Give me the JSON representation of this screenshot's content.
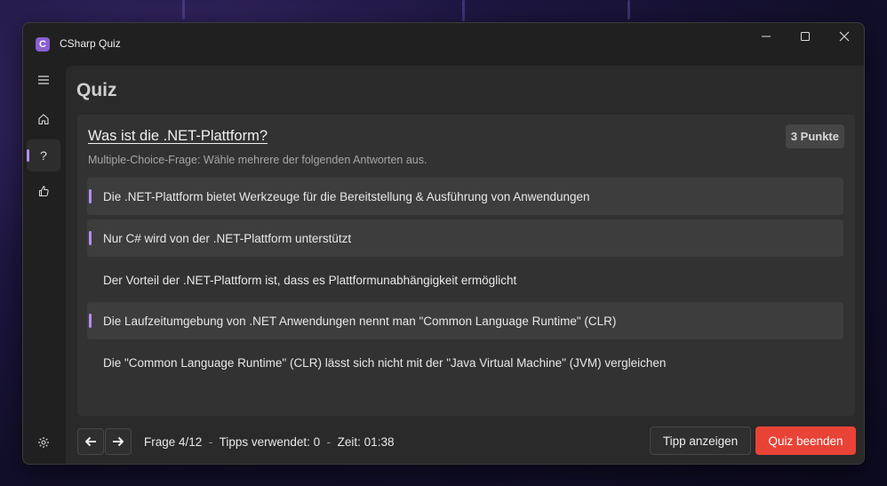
{
  "window": {
    "app_title": "CSharp Quiz",
    "app_logo_glyph": "C",
    "icons": [
      "minimize-icon",
      "maximize-icon",
      "close-icon"
    ]
  },
  "sidebar": {
    "items": [
      {
        "name": "menu",
        "icon": "hamburger-icon",
        "glyph": "≡"
      },
      {
        "name": "home",
        "icon": "home-icon"
      },
      {
        "name": "quiz",
        "icon": "question-icon",
        "glyph": "?",
        "active": true
      },
      {
        "name": "like",
        "icon": "thumbs-up-icon"
      },
      {
        "name": "settings",
        "icon": "gear-icon"
      }
    ]
  },
  "page": {
    "title": "Quiz"
  },
  "question": {
    "text": "Was ist die .NET-Plattform?",
    "points": "3 Punkte",
    "instruction": "Multiple-Choice-Frage: Wähle mehrere der folgenden Antworten aus."
  },
  "answers": [
    {
      "text": "Die .NET-Plattform bietet Werkzeuge für die Bereitstellung & Ausführung von Anwendungen",
      "selected": true
    },
    {
      "text": "Nur C# wird von der .NET-Plattform unterstützt",
      "selected": true
    },
    {
      "text": "Der Vorteil der .NET-Plattform ist, dass es Plattformunabhängigkeit ermöglicht",
      "selected": false
    },
    {
      "text": "Die Laufzeitumgebung von .NET Anwendungen nennt man \"Common Language Runtime\" (CLR)",
      "selected": true
    },
    {
      "text": "Die \"Common Language Runtime\" (CLR) lässt sich nicht mit der \"Java Virtual Machine\" (JVM) vergleichen",
      "selected": false
    }
  ],
  "footer": {
    "prev_icon": "arrow-left-icon",
    "next_icon": "arrow-right-icon",
    "question_counter": "Frage 4/12",
    "separator": "-",
    "tips_used": "Tipps verwendet: 0",
    "time": "Zeit: 01:38",
    "tip_button": "Tipp anzeigen",
    "end_button": "Quiz beenden"
  },
  "colors": {
    "accent": "#b38ef0",
    "danger": "#e84336",
    "window_bg": "#202020",
    "card_bg": "#323232"
  }
}
